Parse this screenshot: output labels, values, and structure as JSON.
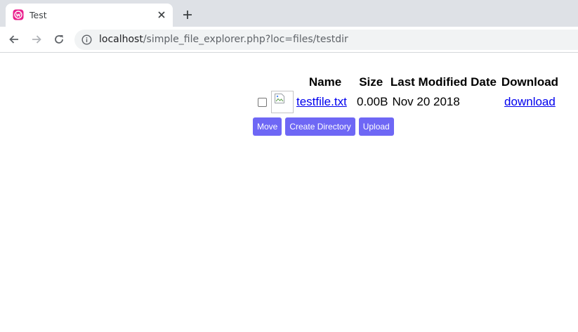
{
  "browser": {
    "tab": {
      "title": "Test"
    },
    "url": {
      "host": "localhost",
      "path": "/simple_file_explorer.php?loc=files/testdir"
    }
  },
  "table": {
    "headers": {
      "name": "Name",
      "size": "Size",
      "modified": "Last Modified Date",
      "download": "Download"
    },
    "rows": [
      {
        "name": "testfile.txt",
        "size": "0.00B",
        "modified": "Nov 20 2018",
        "download": "download"
      }
    ]
  },
  "actions": {
    "move": "Move",
    "create_directory": "Create Directory",
    "upload": "Upload"
  },
  "colors": {
    "button": "#6e67f5",
    "link": "#0000ee",
    "favicon": "#e91e8c"
  },
  "icons": {
    "favicon": "wamp-favicon-icon",
    "thumbnail": "broken-image-icon"
  }
}
